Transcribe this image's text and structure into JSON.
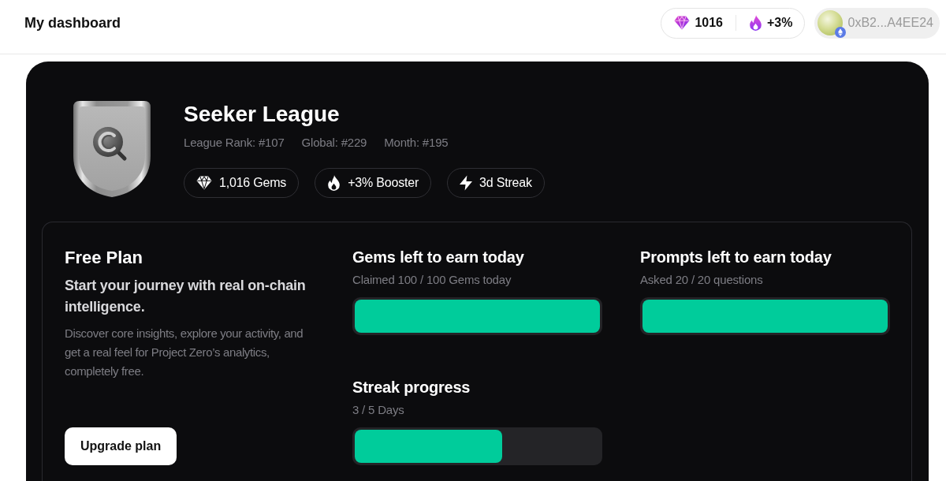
{
  "header": {
    "title": "My dashboard",
    "stats": [
      {
        "kind": "gems",
        "value": "1016"
      },
      {
        "kind": "booster",
        "value": "+3%"
      }
    ],
    "wallet": "0xB2...A4EE24"
  },
  "league": {
    "name": "Seeker League",
    "ranks": [
      "League Rank: #107",
      "Global: #229",
      "Month: #195"
    ],
    "chips": [
      {
        "kind": "gems",
        "label": "1,016 Gems"
      },
      {
        "kind": "booster",
        "label": "+3% Booster"
      },
      {
        "kind": "streak",
        "label": "3d Streak"
      }
    ]
  },
  "plan": {
    "title": "Free Plan",
    "tagline": "Start your journey with real on-chain intelligence.",
    "description": "Discover core insights, explore your activity, and get a real feel for Project Zero’s analytics, completely free.",
    "button": "Upgrade plan"
  },
  "metrics": [
    {
      "title": "Gems left to earn today",
      "caption": "Claimed 100 / 100 Gems today",
      "level": 1
    },
    {
      "title": "Prompts left to earn today",
      "caption": "Asked 20 / 20 questions",
      "level": 1
    },
    {
      "title": "Streak progress",
      "caption": "3 / 5 Days",
      "level": 0.6
    }
  ]
}
